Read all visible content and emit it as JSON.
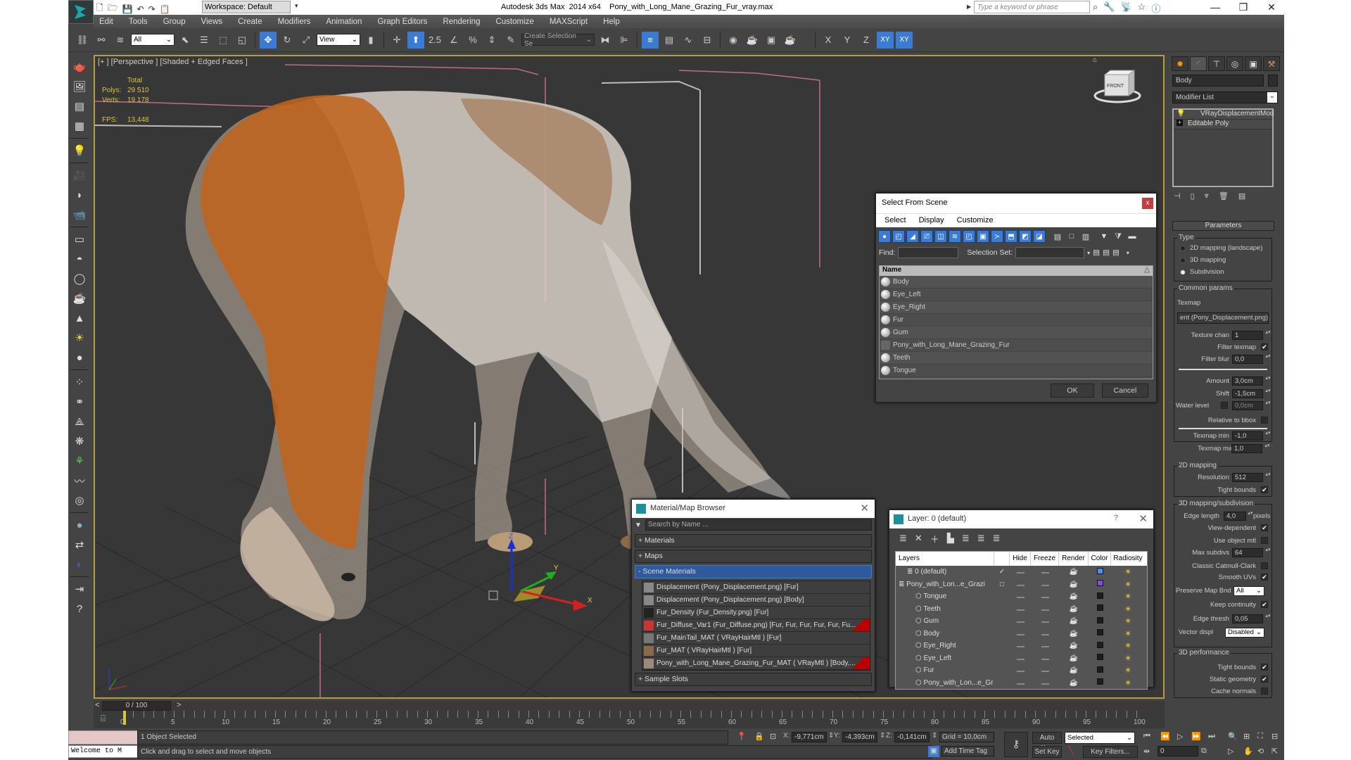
{
  "titlebar": {
    "workspace": "Workspace: Default",
    "app_name": "Autodesk 3ds Max  2014 x64",
    "file_name": "Pony_with_Long_Mane_Grazing_Fur_vray.max",
    "search_placeholder": "Type a keyword or phrase",
    "icons": [
      "binoculars-icon",
      "key-icon",
      "satellite-icon",
      "star-icon",
      "help-icon"
    ],
    "window_controls": {
      "minimize": "—",
      "maximize": "❐",
      "close": "✕"
    }
  },
  "menu": [
    "Edit",
    "Tools",
    "Group",
    "Views",
    "Create",
    "Modifiers",
    "Animation",
    "Graph Editors",
    "Rendering",
    "Customize",
    "MAXScript",
    "Help"
  ],
  "toolbar": {
    "selection_filter": "All",
    "ref_coord": "View",
    "snap_angle_label": "2.5",
    "named_selection_placeholder": "Create Selection Se",
    "axis_buttons": [
      "X",
      "Y",
      "Z",
      "XY",
      "XY"
    ]
  },
  "viewport": {
    "label": "[+ ] [Perspective ] [Shaded + Edged Faces ]",
    "stats": {
      "total_label": "Total",
      "polys_label": "Polys:",
      "polys_value": "29 510",
      "verts_label": "Verts:",
      "verts_value": "19 178",
      "fps_label": "FPS:",
      "fps_value": "13,448"
    },
    "viewcube_label": "FRONT",
    "gizmo_axes": [
      "X",
      "Y",
      "Z"
    ]
  },
  "command_panel": {
    "tabs": [
      "create-icon",
      "modify-icon",
      "hierarchy-icon",
      "motion-icon",
      "display-icon",
      "utilities-icon"
    ],
    "object_name": "Body",
    "modifier_list": "Modifier List",
    "stack": [
      "VRayDisplacementMod",
      "Editable Poly"
    ],
    "parameters": {
      "header": "Parameters",
      "type_label": "Type",
      "type_options": [
        {
          "label": "2D mapping (landscape)",
          "selected": false
        },
        {
          "label": "3D mapping",
          "selected": false
        },
        {
          "label": "Subdivision",
          "selected": true
        }
      ],
      "common_label": "Common params",
      "texmap_label": "Texmap",
      "texmap_value": "ent (Pony_Displacement.png)",
      "texture_chan_label": "Texture chan",
      "texture_chan": "1",
      "filter_texmap_label": "Filter texmap",
      "filter_texmap": true,
      "filter_blur_label": "Filter blur",
      "filter_blur": "0,0",
      "amount_label": "Amount",
      "amount": "3,0cm",
      "shift_label": "Shift",
      "shift": "-1,5cm",
      "water_level_label": "Water level",
      "water_level_checked": false,
      "water_level": "0,0cm",
      "relative_bbox_label": "Relative to bbox",
      "relative_bbox": false,
      "texmap_min_label": "Texmap min",
      "texmap_min": "-1,0",
      "texmap_max_label": "Texmap max",
      "texmap_max": "1,0",
      "mapping2d_label": "2D mapping",
      "resolution_label": "Resolution",
      "resolution": "512",
      "tight_bounds_label": "Tight bounds",
      "tight_bounds_2d": true,
      "mapping3d_label": "3D mapping/subdivision",
      "edge_length_label": "Edge length",
      "edge_length": "4,0",
      "pixels_label": "pixels",
      "view_dependent_label": "View-dependent",
      "view_dependent": true,
      "use_object_mtl_label": "Use object mtl",
      "use_object_mtl": false,
      "max_subdivs_label": "Max subdivs",
      "max_subdivs": "64",
      "catmull_label": "Classic Catmull-Clark",
      "catmull": false,
      "smooth_uvs_label": "Smooth UVs",
      "smooth_uvs": true,
      "preserve_map_label": "Preserve Map Bnd",
      "preserve_map": "All",
      "keep_continuity_label": "Keep continuity",
      "keep_continuity": true,
      "edge_thresh_label": "Edge thresh",
      "edge_thresh": "0,05",
      "vector_displ_label": "Vector displ",
      "vector_displ": "Disabled",
      "performance_label": "3D performance",
      "tight_bounds_3d": true,
      "static_geometry_label": "Static geometry",
      "static_geometry": true,
      "cache_normals_label": "Cache normals",
      "cache_normals": false
    }
  },
  "select_from_scene": {
    "title": "Select From Scene",
    "close": "x",
    "menu": [
      "Select",
      "Display",
      "Customize"
    ],
    "find_label": "Find:",
    "selection_set_label": "Selection Set:",
    "column_name": "Name",
    "items": [
      "Body",
      "Eye_Left",
      "Eye_Right",
      "Fur",
      "Gum",
      "Pony_with_Long_Mane_Grazing_Fur",
      "Teeth",
      "Tongue"
    ],
    "ok": "OK",
    "cancel": "Cancel"
  },
  "material_browser": {
    "title": "Material/Map Browser",
    "search_placeholder": "Search by Name ...",
    "categories": [
      "+ Materials",
      "+ Maps",
      "- Scene Materials"
    ],
    "scene_materials": [
      {
        "label": "Displacement (Pony_Displacement.png)  [Fur]",
        "flag": false
      },
      {
        "label": "Displacement (Pony_Displacement.png) [Body]",
        "flag": false
      },
      {
        "label": "Fur_Density (Fur_Density.png)  [Fur]",
        "flag": false
      },
      {
        "label": "Fur_Diffuse_Var1 (Fur_Diffuse.png)  [Fur, Fur, Fur, Fur, Fur, Fu...",
        "flag": true
      },
      {
        "label": "Fur_MainTail_MAT  ( VRayHairMtl )  [Fur]",
        "flag": false
      },
      {
        "label": "Fur_MAT  ( VRayHairMtl )  [Fur]",
        "flag": false
      },
      {
        "label": "Pony_with_Long_Mane_Grazing_Fur_MAT  ( VRayMtl )  [Body,...",
        "flag": true
      }
    ],
    "sample_slots": "+ Sample Slots"
  },
  "layer_dialog": {
    "title": "Layer: 0 (default)",
    "help": "?",
    "close": "✕",
    "columns": [
      "Layers",
      "",
      "Hide",
      "Freeze",
      "Render",
      "Color",
      "Radiosity"
    ],
    "rows": [
      {
        "name": "0 (default)",
        "indent": 1,
        "current": "✓",
        "color": "#4a8ef0"
      },
      {
        "name": "Pony_with_Lon...e_Grazi",
        "indent": 0,
        "current": "□",
        "color": "#8a4ae0"
      },
      {
        "name": "Tongue",
        "indent": 2,
        "current": "",
        "color": "#1e1e1e"
      },
      {
        "name": "Teeth",
        "indent": 2,
        "current": "",
        "color": "#1e1e1e"
      },
      {
        "name": "Gum",
        "indent": 2,
        "current": "",
        "color": "#1e1e1e"
      },
      {
        "name": "Body",
        "indent": 2,
        "current": "",
        "color": "#1e1e1e"
      },
      {
        "name": "Eye_Right",
        "indent": 2,
        "current": "",
        "color": "#1e1e1e"
      },
      {
        "name": "Eye_Left",
        "indent": 2,
        "current": "",
        "color": "#1e1e1e"
      },
      {
        "name": "Fur",
        "indent": 2,
        "current": "",
        "color": "#1e1e1e"
      },
      {
        "name": "Pony_with_Lon...e_Gr",
        "indent": 2,
        "current": "",
        "color": "#1e1e1e"
      }
    ]
  },
  "timeline": {
    "frame_display": "0 / 100",
    "prev": "<",
    "next": ">",
    "ticks": [
      "0",
      "5",
      "10",
      "15",
      "20",
      "25",
      "30",
      "35",
      "40",
      "45",
      "50",
      "55",
      "60",
      "65",
      "70",
      "75",
      "80",
      "85",
      "90",
      "95",
      "100"
    ]
  },
  "status": {
    "maxscript_listener": "Welcome to M",
    "selection": "1 Object Selected",
    "prompt": "Click and drag to select and move objects",
    "x_label": "X:",
    "x": "-9,771cm",
    "y_label": "Y:",
    "y": "-4,393cm",
    "z_label": "Z:",
    "z": "-0,141cm",
    "grid": "Grid = 10,0cm",
    "add_time_tag": "Add Time Tag",
    "auto_key": "Auto Key",
    "set_key": "Set Key",
    "key_mode": "Selected",
    "key_filters": "Key Filters...",
    "current_frame": "0"
  },
  "colors": {
    "accent_blue": "#3a7bd5",
    "viewport_border": "#b99d3a",
    "stats_yellow": "#d6c736",
    "scene_material_selected": "#2d5a9c"
  }
}
